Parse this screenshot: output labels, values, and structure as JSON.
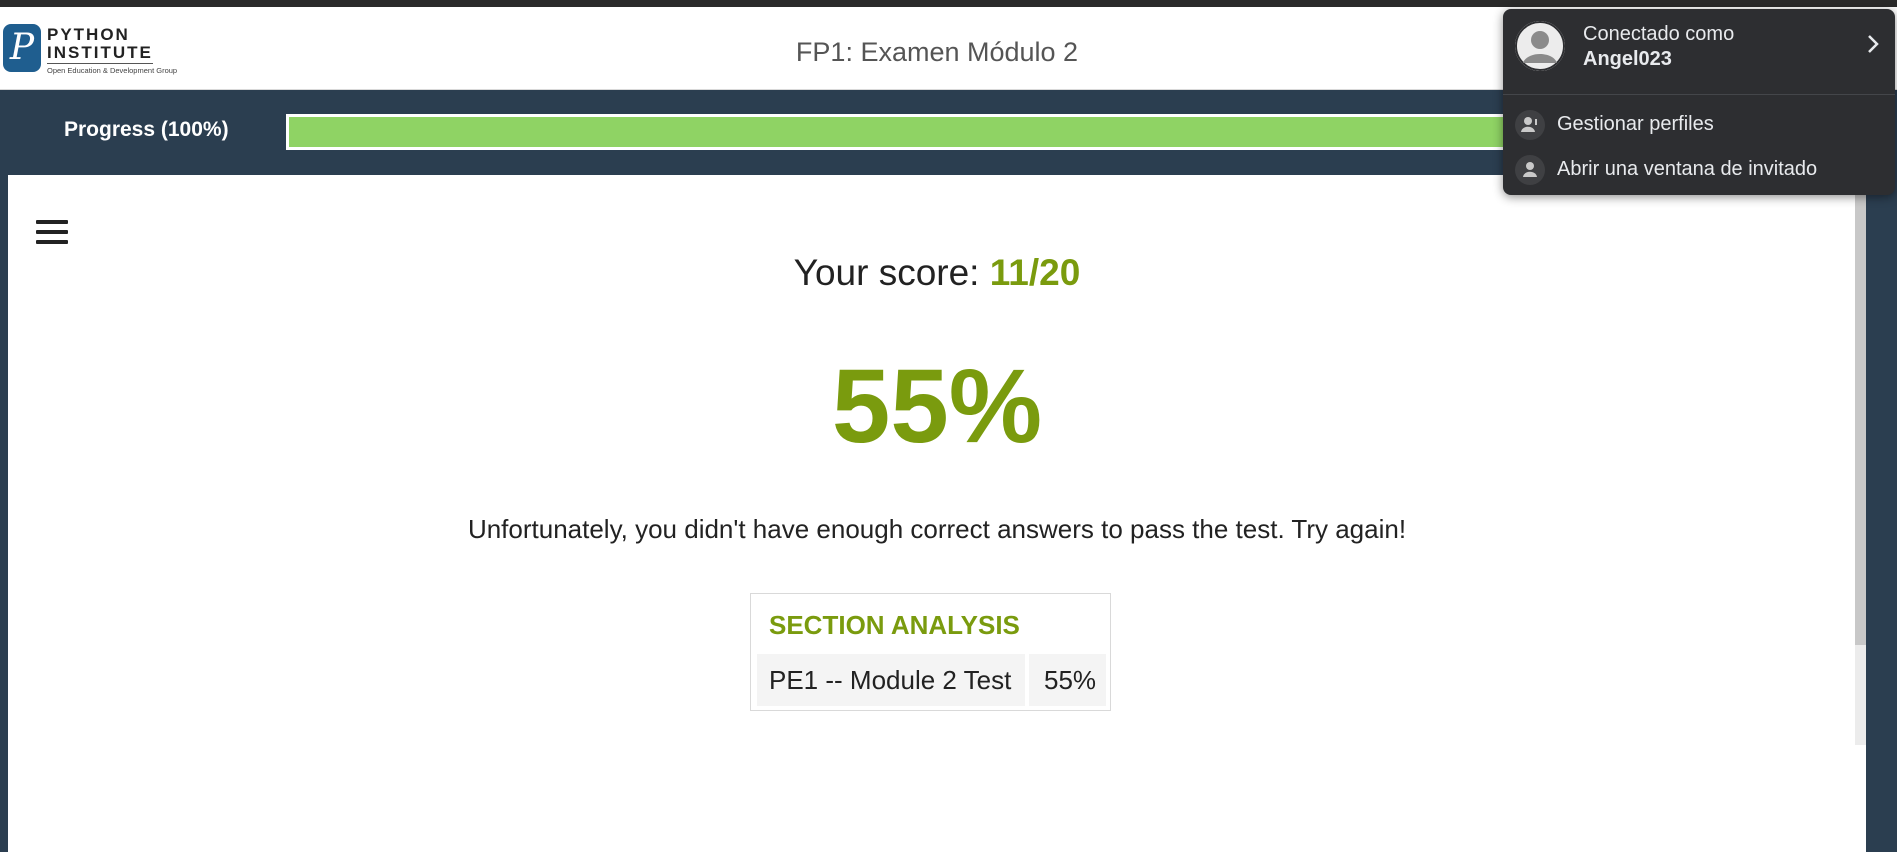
{
  "header": {
    "logo": {
      "line1": "PYTHON",
      "line2": "INSTITUTE",
      "tagline": "Open Education & Development Group",
      "mark": "P"
    },
    "title": "FP1: Examen Módulo 2"
  },
  "progress": {
    "label": "Progress (100%)",
    "value": 1.0,
    "fill_color": "#8fd364"
  },
  "result": {
    "score_label": "Your score:",
    "score_value": "11/20",
    "percent": "55%",
    "message": "Unfortunately, you didn't have enough correct answers to pass the test. Try again!",
    "accent_color": "#7a9b0e"
  },
  "section_analysis": {
    "title": "SECTION ANALYSIS",
    "rows": [
      {
        "name": "PE1 -- Module 2 Test",
        "value": "55%"
      }
    ]
  },
  "profile_menu": {
    "connected_label": "Conectado como",
    "username": "Angel023",
    "items": [
      {
        "label": "Gestionar perfiles",
        "icon": "manage-profiles-icon"
      },
      {
        "label": "Abrir una ventana de invitado",
        "icon": "guest-icon"
      }
    ]
  }
}
